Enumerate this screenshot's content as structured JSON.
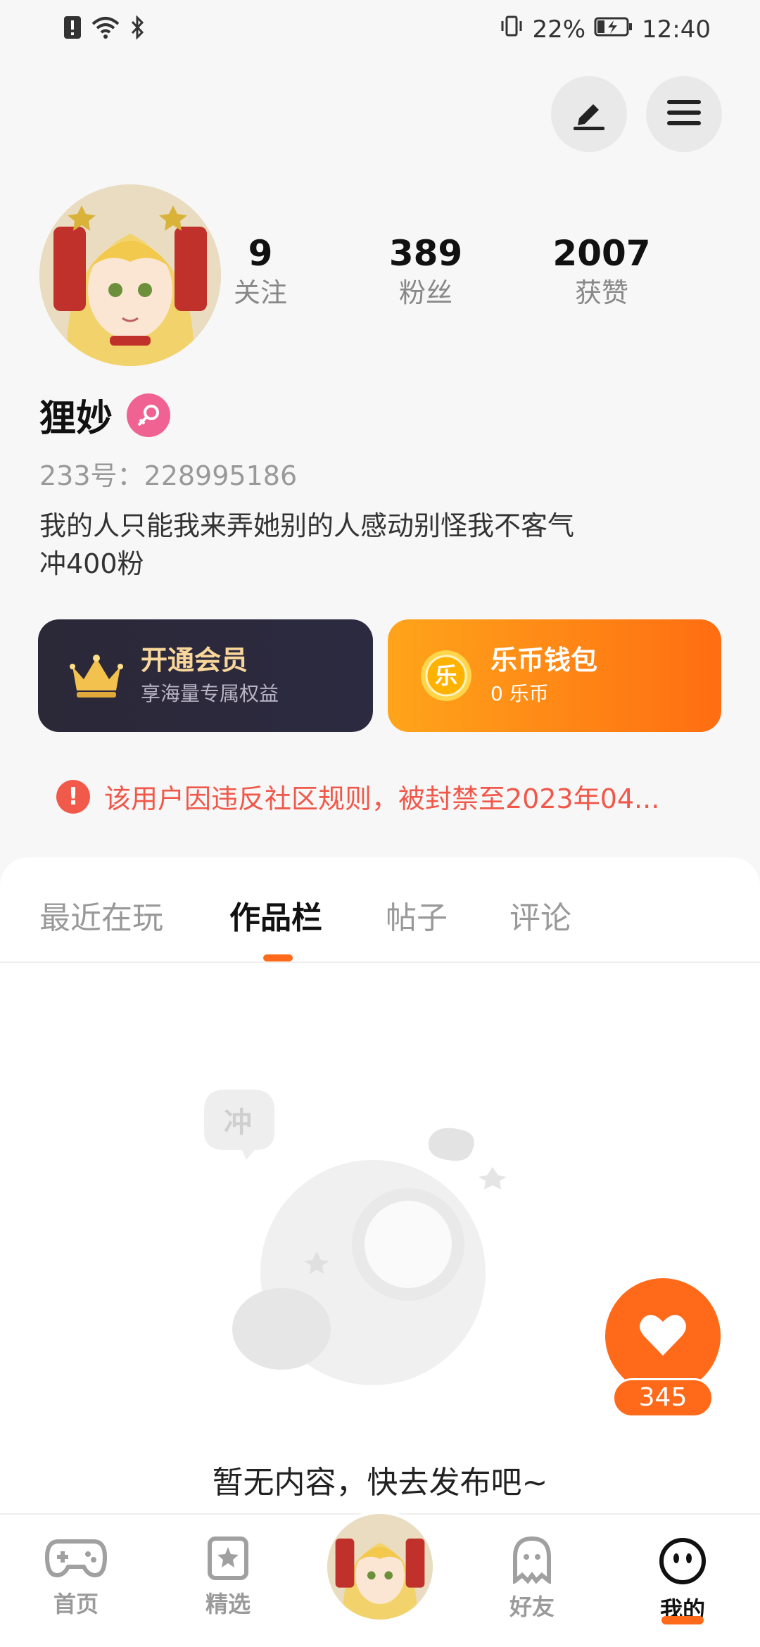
{
  "status_bar": {
    "battery": "22%",
    "time": "12:40"
  },
  "profile": {
    "nickname": "狸妙",
    "uid_label": "233号：",
    "uid": "228995186",
    "bio_line1": "我的人只能我来弄她别的人感动别怪我不客气",
    "bio_line2": "冲400粉"
  },
  "stats": [
    {
      "num": "9",
      "label": "关注"
    },
    {
      "num": "389",
      "label": "粉丝"
    },
    {
      "num": "2007",
      "label": "获赞"
    }
  ],
  "vip_card": {
    "title": "开通会员",
    "subtitle": "享海量专属权益"
  },
  "wallet_card": {
    "title": "乐币钱包",
    "subtitle": "0 乐币",
    "icon_glyph": "乐"
  },
  "notice": {
    "text": "该用户因违反社区规则，被封禁至2023年04..."
  },
  "tabs": [
    {
      "label": "最近在玩",
      "active": false
    },
    {
      "label": "作品栏",
      "active": true
    },
    {
      "label": "帖子",
      "active": false
    },
    {
      "label": "评论",
      "active": false
    }
  ],
  "empty_state": {
    "text": "暂无内容，快去发布吧~",
    "bubble_glyph": "冲"
  },
  "like": {
    "count": "345"
  },
  "bottom_nav": [
    {
      "label": "首页",
      "icon": "gamepad-icon"
    },
    {
      "label": "精选",
      "icon": "star-card-icon"
    },
    {
      "label": "",
      "icon": "avatar-center"
    },
    {
      "label": "好友",
      "icon": "ghost-icon"
    },
    {
      "label": "我的",
      "icon": "face-icon",
      "active": true
    }
  ],
  "colors": {
    "accent": "#ff6a1a",
    "notice": "#f0584a",
    "vip_gold": "#f9d79b"
  }
}
